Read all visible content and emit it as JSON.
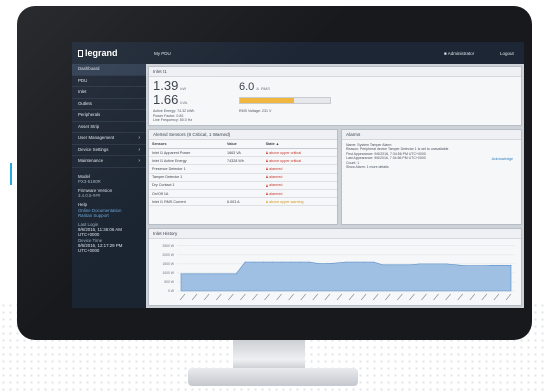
{
  "topbar": {
    "brand": "legrand",
    "page": "My PDU",
    "user": "Administrator",
    "logout": "Logout"
  },
  "sidebar": {
    "items": [
      {
        "label": "Dashboard",
        "active": true,
        "chevron": false
      },
      {
        "label": "PDU",
        "chevron": false
      },
      {
        "label": "Inlet",
        "chevron": false
      },
      {
        "label": "Outlets",
        "chevron": false
      },
      {
        "label": "Peripherals",
        "chevron": false
      },
      {
        "label": "Asset Strip",
        "chevron": false
      },
      {
        "label": "User Management",
        "chevron": true
      },
      {
        "label": "Device Settings",
        "chevron": true
      },
      {
        "label": "Maintenance",
        "chevron": true
      }
    ],
    "info": {
      "model_label": "Model",
      "model_value": "PX3-5190R",
      "firmware_label": "Firmware Version",
      "firmware_value": "3.4.0.5-###",
      "help_label": "Help",
      "online_doc": "Online Documentation",
      "support": "Raritan Support",
      "last_login_label": "Last Login",
      "last_login_value": "9/6/2016, 11:36:06 AM UTC+0000",
      "device_time_label": "Device Time",
      "device_time_value": "9/6/2016, 12:17:29 PM UTC+0000"
    }
  },
  "inlet": {
    "title": "Inlet I1",
    "power_value": "1.39",
    "power_unit": "kW",
    "apparent_value": "1.66",
    "apparent_unit": "kVA",
    "active_energy": "Active Energy: 74.32 kWh",
    "power_factor": "Power Factor: 0.83",
    "line_frequency": "Line Frequency: 50.0 Hz",
    "current_value": "6.0",
    "current_unit": "A",
    "current_max": "RMS",
    "current_fill": 0.6,
    "voltage": "RMS Voltage: 231 V"
  },
  "alerted": {
    "title": "Alerted Sensors (8 Critical, 1 Warned)",
    "headers": [
      "Sensors",
      "Value",
      "State"
    ],
    "rows": [
      {
        "sensor": "Inlet I1 Apparent Power",
        "value": "1663 VA",
        "state": "above upper critical",
        "level": "critical"
      },
      {
        "sensor": "Inlet I1 Active Energy",
        "value": "74328 Wh",
        "state": "above upper critical",
        "level": "critical"
      },
      {
        "sensor": "Presence Detector 1",
        "value": "",
        "state": "alarmed",
        "level": "critical"
      },
      {
        "sensor": "Tamper Detector 1",
        "value": "",
        "state": "alarmed",
        "level": "critical"
      },
      {
        "sensor": "Dry Contact 1",
        "value": "",
        "state": "alarmed",
        "level": "critical"
      },
      {
        "sensor": "On/Off 1A",
        "value": "",
        "state": "alarmed",
        "level": "critical"
      },
      {
        "sensor": "Inlet I1 RMS Current",
        "value": "6.003 A",
        "state": "above upper warning",
        "level": "warning"
      }
    ]
  },
  "alarms": {
    "title": "Alarms",
    "lines": [
      "Name: System Tamper Alarm",
      "Reason: Peripheral device Tamper Detector 1 is set to unavailable",
      "First Appearance: 9/6/2016, 7:34:56 PM UTC+0000",
      "Last Appearance: 9/6/2016, 7:34:56 PM UTC+0000",
      "Count: 1",
      "Show Alarm: 1 more details"
    ],
    "acknowledge": "Acknowledge"
  },
  "history": {
    "title": "Inlet History"
  },
  "chart_data": {
    "type": "area",
    "title": "Inlet History",
    "yticks": [
      "2500 W",
      "2000 W",
      "1500 W",
      "1000 W",
      "500 W",
      "0 W"
    ],
    "ylim": [
      0,
      2600
    ],
    "values": [
      950,
      950,
      950,
      950,
      950,
      950,
      950,
      1600,
      1600,
      1600,
      1600,
      1600,
      1600,
      1600,
      1600,
      1520,
      1520,
      1550,
      1600,
      1600,
      1600,
      1600,
      1450,
      1450,
      1450,
      1450,
      1500,
      1500,
      1500,
      1500,
      1450,
      1400,
      1400,
      1400,
      1420,
      1420,
      1420
    ],
    "fill_color": "#9fc0e2",
    "line_color": "#5b8fc8"
  }
}
